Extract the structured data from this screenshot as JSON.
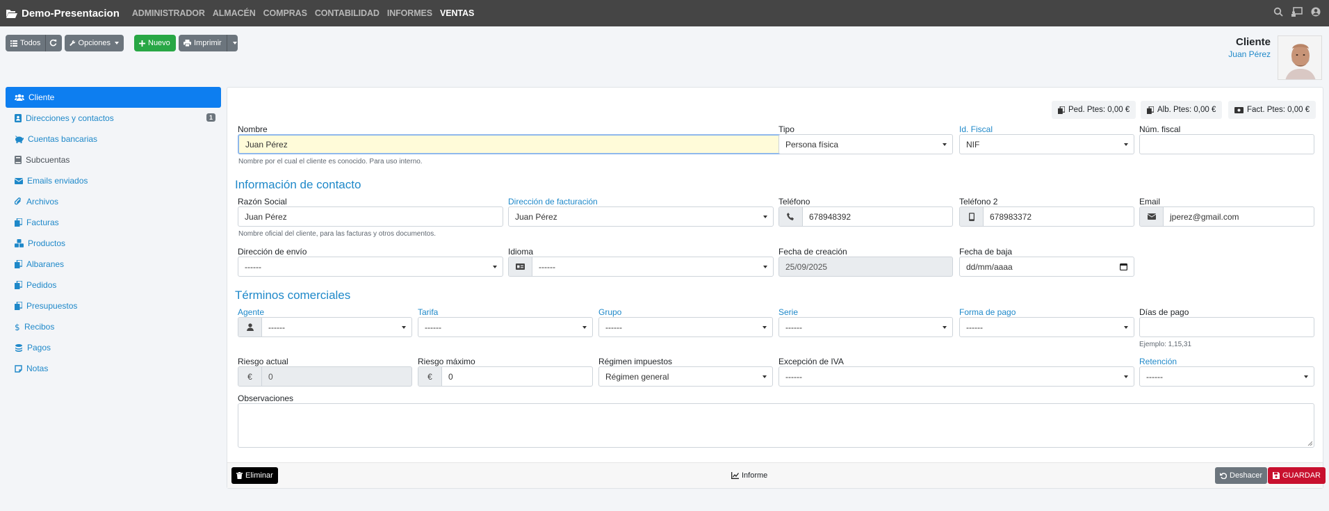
{
  "app": {
    "brand": "Demo-Presentacion",
    "menu": [
      "ADMINISTRADOR",
      "ALMACÉN",
      "COMPRAS",
      "CONTABILIDAD",
      "INFORMES",
      "VENTAS"
    ],
    "active_menu": "VENTAS"
  },
  "toolbar": {
    "todos": "Todos",
    "opciones": "Opciones",
    "nuevo": "Nuevo",
    "imprimir": "Imprimir"
  },
  "header": {
    "title": "Cliente",
    "subtitle": "Juan Pérez"
  },
  "sidebar": {
    "items": [
      {
        "label": "Cliente",
        "icon": "users-icon",
        "active": true
      },
      {
        "label": "Direcciones y contactos",
        "icon": "address-book-icon",
        "badge": "1"
      },
      {
        "label": "Cuentas bancarias",
        "icon": "piggy-bank-icon"
      },
      {
        "label": "Subcuentas",
        "icon": "book-icon"
      },
      {
        "label": "Emails enviados",
        "icon": "envelope-icon"
      },
      {
        "label": "Archivos",
        "icon": "paperclip-icon"
      },
      {
        "label": "Facturas",
        "icon": "copy-icon"
      },
      {
        "label": "Productos",
        "icon": "cubes-icon"
      },
      {
        "label": "Albaranes",
        "icon": "copy-icon"
      },
      {
        "label": "Pedidos",
        "icon": "copy-icon"
      },
      {
        "label": "Presupuestos",
        "icon": "copy-icon"
      },
      {
        "label": "Recibos",
        "icon": "dollar-icon"
      },
      {
        "label": "Pagos",
        "icon": "coins-icon"
      },
      {
        "label": "Notas",
        "icon": "sticky-note-icon"
      }
    ]
  },
  "pills": {
    "pedidos": "Ped. Ptes: 0,00 €",
    "albaranes": "Alb. Ptes: 0,00 €",
    "facturas": "Fact. Ptes: 0,00 €"
  },
  "form": {
    "nombre_label": "Nombre",
    "nombre_value": "Juan Pérez",
    "nombre_hint": "Nombre por el cual el cliente es conocido. Para uso interno.",
    "tipo_label": "Tipo",
    "tipo_value": "Persona física",
    "idfiscal_label": "Id. Fiscal",
    "idfiscal_value": "NIF",
    "numfiscal_label": "Núm. fiscal",
    "numfiscal_value": "",
    "section_contacto": "Información de contacto",
    "razon_label": "Razón Social",
    "razon_value": "Juan Pérez",
    "razon_hint": "Nombre oficial del cliente, para las facturas y otros documentos.",
    "dirfact_label": "Dirección de facturación",
    "dirfact_value": "Juan Pérez",
    "telefono_label": "Teléfono",
    "telefono_value": "678948392",
    "telefono2_label": "Teléfono 2",
    "telefono2_value": "678983372",
    "email_label": "Email",
    "email_value": "jperez@gmail.com",
    "direnvio_label": "Dirección de envío",
    "direnvio_value": "------",
    "idioma_label": "Idioma",
    "idioma_value": "------",
    "fechacreacion_label": "Fecha de creación",
    "fechacreacion_value": "25/09/2025",
    "fechabaja_label": "Fecha de baja",
    "fechabaja_placeholder": "dd/mm/aaaa",
    "section_terminos": "Términos comerciales",
    "agente_label": "Agente",
    "agente_value": "------",
    "tarifa_label": "Tarifa",
    "tarifa_value": "------",
    "grupo_label": "Grupo",
    "grupo_value": "------",
    "serie_label": "Serie",
    "serie_value": "------",
    "formapago_label": "Forma de pago",
    "formapago_value": "------",
    "diaspago_label": "Días de pago",
    "diaspago_value": "",
    "diaspago_hint": "Ejemplo: 1,15,31",
    "riesgoactual_label": "Riesgo actual",
    "riesgoactual_value": "0",
    "riesgomax_label": "Riesgo máximo",
    "riesgomax_value": "0",
    "currency_symbol": "€",
    "regimen_label": "Régimen impuestos",
    "regimen_value": "Régimen general",
    "excepcion_label": "Excepción de IVA",
    "excepcion_value": "------",
    "retencion_label": "Retención",
    "retencion_value": "------",
    "observaciones_label": "Observaciones",
    "observaciones_value": ""
  },
  "footer": {
    "eliminar": "Eliminar",
    "informe": "Informe",
    "deshacer": "Deshacer",
    "guardar": "GUARDAR"
  },
  "colors": {
    "navbar": "#454545",
    "accent": "#1e88c9",
    "active": "#0d7ef0",
    "success": "#28a745",
    "danger": "#c8102e"
  }
}
